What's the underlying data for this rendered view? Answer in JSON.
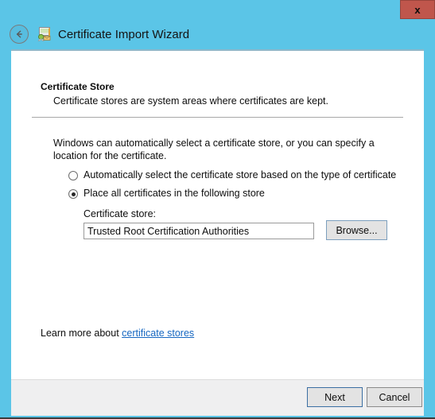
{
  "window": {
    "title": "Certificate Import Wizard",
    "title_icon": "certificate-icon",
    "back_icon": "back-arrow-icon",
    "close_label": "x",
    "frame_color": "#5BC5E7",
    "close_color": "#C0564C"
  },
  "page": {
    "heading": "Certificate Store",
    "subheading": "Certificate stores are system areas where certificates are kept.",
    "body_text": "Windows can automatically select a certificate store, or you can specify a location for the certificate."
  },
  "options": {
    "auto": {
      "label": "Automatically select the certificate store based on the type of certificate",
      "selected": false
    },
    "place": {
      "label": "Place all certificates in the following store",
      "selected": true
    }
  },
  "store": {
    "label": "Certificate store:",
    "value": "Trusted Root Certification Authorities",
    "placeholder": "",
    "browse_label": "Browse..."
  },
  "learn_more": {
    "prefix": "Learn more about ",
    "link_text": "certificate stores",
    "link_color": "#1667c1"
  },
  "footer": {
    "next_label": "Next",
    "cancel_label": "Cancel"
  }
}
